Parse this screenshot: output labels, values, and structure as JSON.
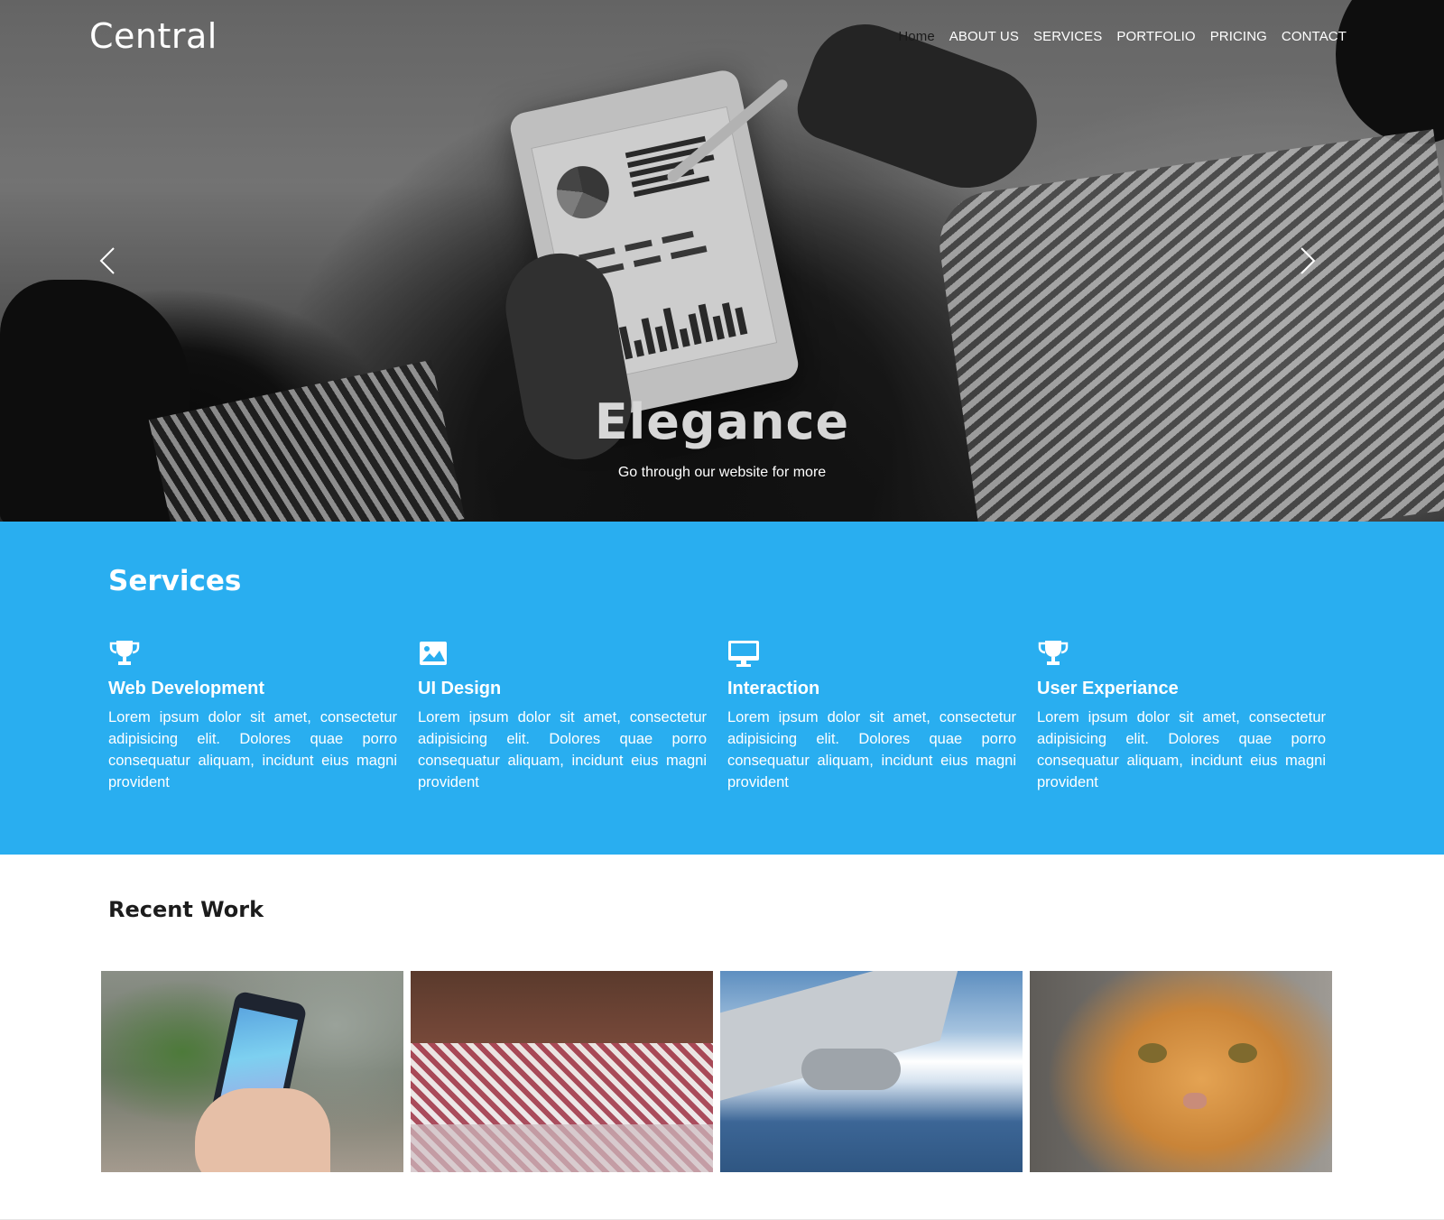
{
  "header": {
    "brand": "Central",
    "nav": [
      "Home",
      "ABOUT US",
      "SERVICES",
      "PORTFOLIO",
      "PRICING",
      "CONTACT"
    ],
    "active_nav": "Home"
  },
  "hero": {
    "title": "Elegance",
    "subtitle": "Go through our website for more",
    "prev_icon": "chevron-left-icon",
    "next_icon": "chevron-right-icon"
  },
  "services": {
    "title": "Services",
    "background_color": "#29aef0",
    "items": [
      {
        "icon": "trophy-icon",
        "title": "Web Development",
        "text": "Lorem ipsum dolor sit amet, consectetur adipisicing elit. Dolores quae porro consequatur aliquam, incidunt eius magni provident"
      },
      {
        "icon": "image-icon",
        "title": "UI Design",
        "text": "Lorem ipsum dolor sit amet, consectetur adipisicing elit. Dolores quae porro consequatur aliquam, incidunt eius magni provident"
      },
      {
        "icon": "monitor-icon",
        "title": "Interaction",
        "text": "Lorem ipsum dolor sit amet, consectetur adipisicing elit. Dolores quae porro consequatur aliquam, incidunt eius magni provident"
      },
      {
        "icon": "trophy-icon",
        "title": "User Experiance",
        "text": "Lorem ipsum dolor sit amet, consectetur adipisicing elit. Dolores quae porro consequatur aliquam, incidunt eius magni provident"
      }
    ]
  },
  "recent_work": {
    "title": "Recent Work"
  }
}
